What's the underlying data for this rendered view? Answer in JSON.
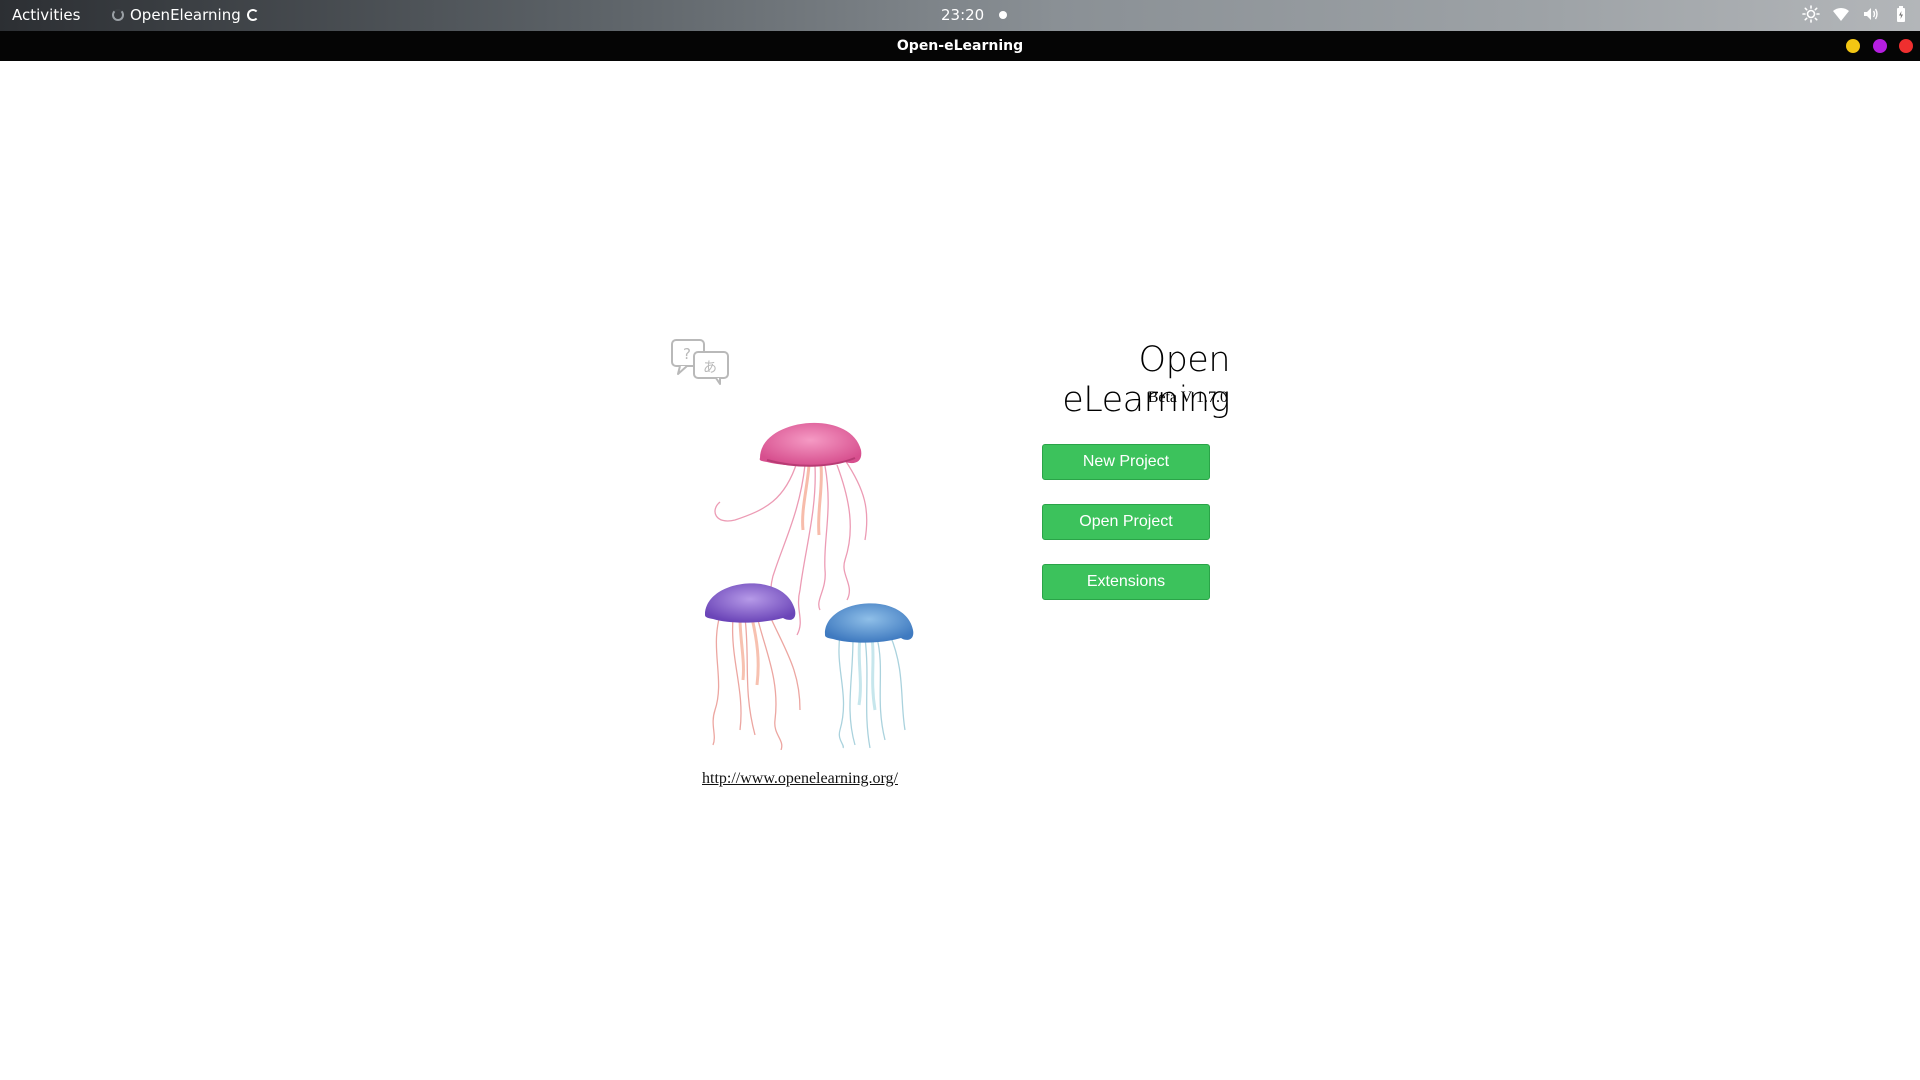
{
  "topbar": {
    "activities_label": "Activities",
    "app_name": "OpenElearning",
    "clock": "23:20",
    "tray_icons": [
      "brightness-icon",
      "wifi-icon",
      "volume-icon",
      "battery-icon"
    ]
  },
  "window": {
    "title": "Open-eLearning",
    "controls": [
      "minimize",
      "maximize",
      "close"
    ],
    "control_colors": {
      "minimize": "#f3c613",
      "maximize": "#b51ee0",
      "close": "#ef2f2f"
    }
  },
  "main": {
    "app_title": "Open eLearning",
    "version": "Beta V 1.7.0",
    "buttons": {
      "new_project": "New Project",
      "open_project": "Open Project",
      "extensions": "Extensions"
    },
    "button_color": "#3cc25c",
    "website_link": "http://www.openelearning.org/",
    "illustration": "jellyfish-illustration",
    "language_icon": "language-translate-icon"
  }
}
